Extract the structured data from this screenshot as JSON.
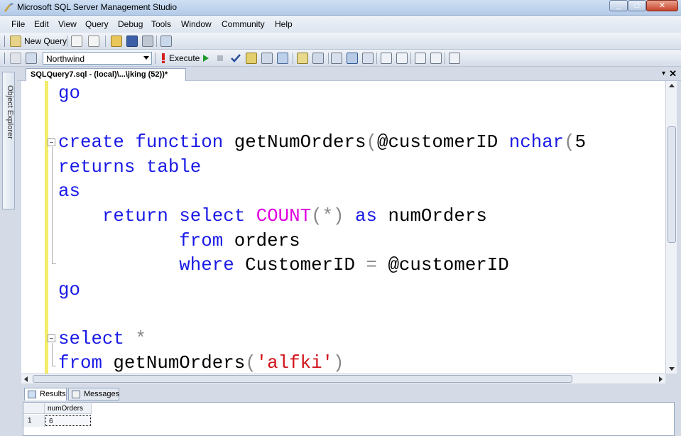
{
  "window": {
    "title": "Microsoft SQL Server Management Studio",
    "min_glyph": "_",
    "max_glyph": "□",
    "close_glyph": "✕"
  },
  "menu": [
    "File",
    "Edit",
    "View",
    "Query",
    "Debug",
    "Tools",
    "Window",
    "Community",
    "Help"
  ],
  "toolbar": {
    "new_query": "New Query",
    "database": "Northwind",
    "execute": "Execute"
  },
  "object_explorer": {
    "label": "Object Explorer"
  },
  "document_tab": {
    "label": "SQLQuery7.sql - (local)\\...\\jking (52))*",
    "dropdown_glyph": "▾",
    "close_glyph": "✕"
  },
  "editor": {
    "lines": [
      [
        {
          "t": "go",
          "c": "kw"
        }
      ],
      [],
      [
        {
          "t": "create",
          "c": "kw"
        },
        {
          "t": " ",
          "c": "tx"
        },
        {
          "t": "function",
          "c": "kw"
        },
        {
          "t": " getNumOrders",
          "c": "tx"
        },
        {
          "t": "(",
          "c": "op"
        },
        {
          "t": "@customerID ",
          "c": "tx"
        },
        {
          "t": "nchar",
          "c": "kw"
        },
        {
          "t": "(",
          "c": "op"
        },
        {
          "t": "5",
          "c": "tx"
        }
      ],
      [
        {
          "t": "returns",
          "c": "kw"
        },
        {
          "t": " ",
          "c": "tx"
        },
        {
          "t": "table",
          "c": "kw"
        }
      ],
      [
        {
          "t": "as",
          "c": "kw"
        }
      ],
      [
        {
          "t": "    ",
          "c": "tx"
        },
        {
          "t": "return",
          "c": "kw"
        },
        {
          "t": " ",
          "c": "tx"
        },
        {
          "t": "select",
          "c": "kw"
        },
        {
          "t": " ",
          "c": "tx"
        },
        {
          "t": "COUNT",
          "c": "fn"
        },
        {
          "t": "(*)",
          "c": "op"
        },
        {
          "t": " ",
          "c": "tx"
        },
        {
          "t": "as",
          "c": "kw"
        },
        {
          "t": " numOrders",
          "c": "tx"
        }
      ],
      [
        {
          "t": "           ",
          "c": "tx"
        },
        {
          "t": "from",
          "c": "kw"
        },
        {
          "t": " orders",
          "c": "tx"
        }
      ],
      [
        {
          "t": "           ",
          "c": "tx"
        },
        {
          "t": "where",
          "c": "kw"
        },
        {
          "t": " CustomerID ",
          "c": "tx"
        },
        {
          "t": "=",
          "c": "op"
        },
        {
          "t": " @customerID",
          "c": "tx"
        }
      ],
      [
        {
          "t": "go",
          "c": "kw"
        }
      ],
      [],
      [
        {
          "t": "select",
          "c": "kw"
        },
        {
          "t": " ",
          "c": "tx"
        },
        {
          "t": "*",
          "c": "op"
        }
      ],
      [
        {
          "t": "from",
          "c": "kw"
        },
        {
          "t": " getNumOrders",
          "c": "tx"
        },
        {
          "t": "(",
          "c": "op"
        },
        {
          "t": "'alfki'",
          "c": "str"
        },
        {
          "t": ")",
          "c": "op"
        }
      ]
    ]
  },
  "results": {
    "tabs": [
      "Results",
      "Messages"
    ],
    "columns": [
      "numOrders"
    ],
    "rows": [
      {
        "num": "1",
        "values": [
          "6"
        ]
      }
    ]
  },
  "colors": {
    "keyword": "#1a1ae6",
    "function": "#e000e0",
    "string": "#d0121b",
    "operator": "#888888",
    "change_bar": "#f3ec6b"
  }
}
